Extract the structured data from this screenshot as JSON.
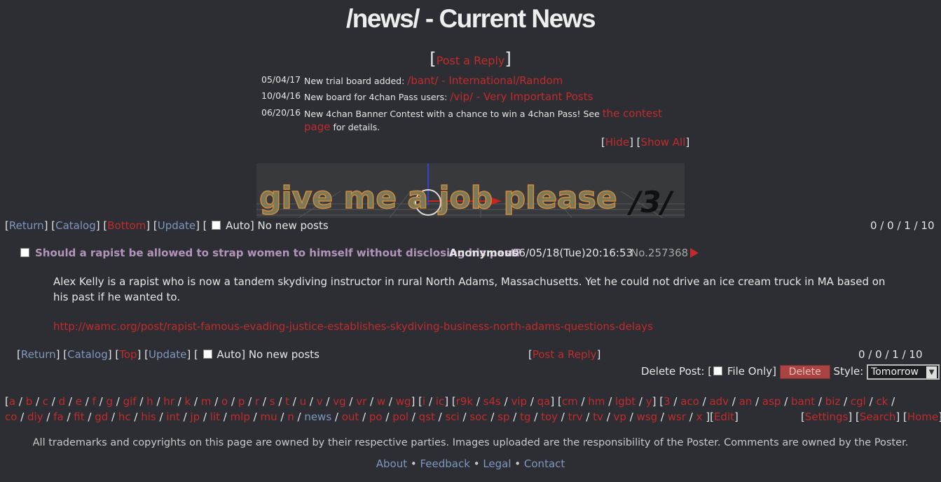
{
  "board_title": "/news/ - Current News",
  "post_reply_label": "Post a Reply",
  "announcements": [
    {
      "date": "05/04/17",
      "text": "New trial board added: ",
      "link": "/bant/ - International/Random",
      "suffix": ""
    },
    {
      "date": "10/04/16",
      "text": "New board for 4chan Pass users: ",
      "link": "/vip/ - Very Important Posts",
      "suffix": ""
    },
    {
      "date": "06/20/16",
      "text": "New 4chan Banner Contest with a chance to win a 4chan Pass! See ",
      "link": "the contest page",
      "suffix": " for details."
    }
  ],
  "hide_label": "Hide",
  "show_all_label": "Show All",
  "banner": {
    "text": "give me a job please",
    "board": "/3/"
  },
  "nav_top": {
    "return": "Return",
    "catalog": "Catalog",
    "bottom": "Bottom",
    "update": "Update",
    "auto": "Auto",
    "status": "No new posts",
    "stats": "0 / 0 / 1 / 10"
  },
  "op": {
    "subject": "Should a rapist be allowed to strap women to himself without disclosing his past?",
    "name": "Anonymous",
    "datetime": "06/05/18(Tue)20:16:53",
    "no_label": "No.",
    "no": "257368",
    "body": "Alex Kelly is a rapist who is now a tandem skydiving instructor in rural North Adams, Massachusetts. Yet he could not drive an ice cream truck in MA based on his past if he wanted to.",
    "link": "http://wamc.org/post/rapist-famous-evading-justice-establishes-skydiving-business-north-adams-questions-delays"
  },
  "nav_bottom": {
    "return": "Return",
    "catalog": "Catalog",
    "top": "Top",
    "update": "Update",
    "auto": "Auto",
    "status": "No new posts",
    "stats": "0 / 0 / 1 / 10"
  },
  "delete_form": {
    "label": "Delete Post: [",
    "file_only": "File Only]",
    "delete_button": "Delete",
    "style_label": "Style:",
    "style_value": "Tomorrow"
  },
  "boardlist": {
    "groups1": [
      [
        "a",
        "b",
        "c",
        "d",
        "e",
        "f",
        "g",
        "gif",
        "h",
        "hr",
        "k",
        "m",
        "o",
        "p",
        "r",
        "s",
        "t",
        "u",
        "v",
        "vg",
        "vr",
        "w",
        "wg"
      ],
      [
        "i",
        "ic"
      ],
      [
        "r9k",
        "s4s",
        "vip",
        "qa"
      ],
      [
        "cm",
        "hm",
        "lgbt",
        "y"
      ],
      [
        "3",
        "aco",
        "adv",
        "an",
        "asp",
        "bant",
        "biz",
        "cgl",
        "ck"
      ]
    ],
    "line2": [
      "co",
      "diy",
      "fa",
      "fit",
      "gd",
      "hc",
      "his",
      "int",
      "jp",
      "lit",
      "mlp",
      "mu",
      "n",
      "news",
      "out",
      "po",
      "pol",
      "qst",
      "sci",
      "soc",
      "sp",
      "tg",
      "toy",
      "trv",
      "tv",
      "vp",
      "wsg",
      "wsr",
      "x"
    ],
    "edit": "Edit",
    "settings": "Settings",
    "search": "Search",
    "home": "Home"
  },
  "footer": {
    "disclaimer": "All trademarks and copyrights on this page are owned by their respective parties. Images uploaded are the responsibility of the Poster. Comments are owned by the Poster.",
    "links": [
      "About",
      "Feedback",
      "Legal",
      "Contact"
    ]
  },
  "colors": {
    "background": "#2d2e33",
    "link": "#c12b2b",
    "subject": "#b294bb",
    "nav_blue": "#7e97bf"
  }
}
